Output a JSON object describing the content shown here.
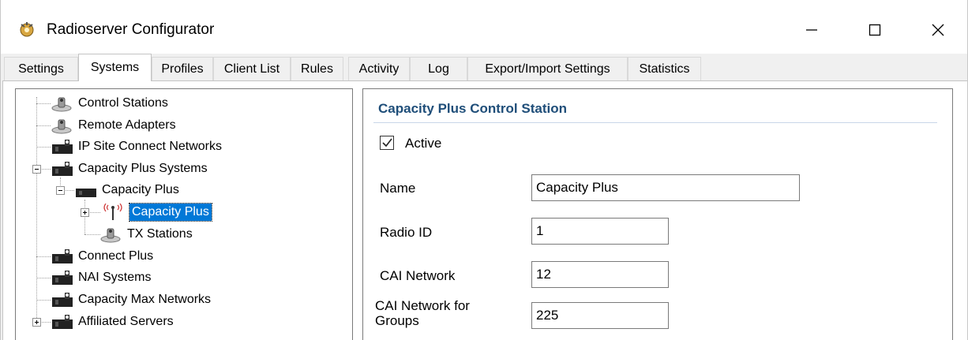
{
  "window": {
    "title": "Radioserver Configurator",
    "icon": "radioserver-app-icon",
    "controls": [
      "minimize-icon",
      "maximize-icon",
      "close-icon"
    ]
  },
  "tabs": [
    {
      "label": "Settings",
      "active": false
    },
    {
      "label": "Systems",
      "active": true
    },
    {
      "label": "Profiles",
      "active": false
    },
    {
      "label": "Client List",
      "active": false
    },
    {
      "label": "Rules",
      "active": false
    },
    {
      "label": "Activity",
      "active": false
    },
    {
      "label": "Log",
      "active": false
    },
    {
      "label": "Export/Import Settings",
      "active": false
    },
    {
      "label": "Statistics",
      "active": false
    }
  ],
  "tree": {
    "items": [
      {
        "label": "Control Stations",
        "icon": "radio-station-icon"
      },
      {
        "label": "Remote Adapters",
        "icon": "radio-station-icon"
      },
      {
        "label": "IP Site Connect Networks",
        "icon": "network-system-icon"
      },
      {
        "label": "Capacity Plus Systems",
        "icon": "network-system-icon",
        "expanded": true
      },
      {
        "label": "Capacity Plus",
        "icon": "network-system-icon",
        "expanded": true
      },
      {
        "label": "Capacity Plus",
        "icon": "antenna-icon",
        "selected": true,
        "expanded": false
      },
      {
        "label": "TX Stations",
        "icon": "radio-station-icon"
      },
      {
        "label": "Connect Plus",
        "icon": "network-system-icon"
      },
      {
        "label": "NAI Systems",
        "icon": "network-system-icon"
      },
      {
        "label": "Capacity Max Networks",
        "icon": "network-system-icon"
      },
      {
        "label": "Affiliated Servers",
        "icon": "network-system-icon",
        "expanded": false
      }
    ]
  },
  "detail": {
    "section_title": "Capacity Plus Control Station",
    "active": {
      "label": "Active",
      "checked": true
    },
    "fields": {
      "name": {
        "label": "Name",
        "value": "Capacity Plus"
      },
      "radio_id": {
        "label": "Radio ID",
        "value": "1"
      },
      "cai_network": {
        "label": "CAI Network",
        "value": "12"
      },
      "cai_network_groups": {
        "label_line1": "CAI Network for",
        "label_line2": "Groups",
        "value": "225"
      }
    }
  },
  "colors": {
    "selection": "#0078d7",
    "section_title": "#1f4e79"
  }
}
